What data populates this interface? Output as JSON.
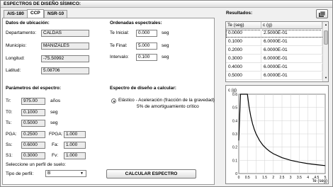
{
  "window": {
    "title": "ESPECTROS DE DISEÑO SÍSMICO:"
  },
  "tabs": [
    {
      "label": "AIS-180",
      "active": false
    },
    {
      "label": "CCP",
      "active": true
    },
    {
      "label": "NSR-10",
      "active": false
    }
  ],
  "ubicacion": {
    "title": "Datos de ubicación:",
    "departamento": {
      "label": "Departamento:",
      "value": "CALDAS"
    },
    "municipio": {
      "label": "Municipio:",
      "value": "MANIZALES"
    },
    "longitud": {
      "label": "Longitud:",
      "value": "-75.50992"
    },
    "latitud": {
      "label": "Latitud:",
      "value": "5.08706"
    }
  },
  "ordenadas": {
    "title": "Ordenadas espectrales:",
    "t_inicial": {
      "label": "Te Inicial:",
      "value": "0.000",
      "unit": "seg"
    },
    "t_final": {
      "label": "Te Final:",
      "value": "5.000",
      "unit": "seg"
    },
    "intervalo": {
      "label": "Intervalo:",
      "value": "0.100",
      "unit": "seg"
    }
  },
  "parametros": {
    "title": "Parámetros del espectro:",
    "tr": {
      "label": "Tr:",
      "value": "975.00",
      "unit": "años"
    },
    "t0": {
      "label": "T0:",
      "value": "0.1000",
      "unit": "seg"
    },
    "ts": {
      "label": "Ts:",
      "value": "0.5000",
      "unit": "seg"
    },
    "pga": {
      "label": "PGA:",
      "value": "0.2500"
    },
    "fpga": {
      "label": "FPGA:",
      "value": "1.000"
    },
    "ss": {
      "label": "Ss:",
      "value": "0.6000"
    },
    "fa": {
      "label": "Fa:",
      "value": "1.000"
    },
    "s1": {
      "label": "S1:",
      "value": "0.3000"
    },
    "fv": {
      "label": "Fv:",
      "value": "1.000"
    },
    "perfil_prompt": "Seleccione un perfil de suelo:",
    "perfil_label": "Tipo de perfil:",
    "perfil_value": "B"
  },
  "espectro": {
    "title": "Espectro de diseño a calcular:",
    "option_line1": "Elástico - Aceleración (fracción de la gravedad)",
    "option_line2": "5% de amortiguamiento crítico",
    "option_selected": true
  },
  "buttons": {
    "calcular": "CALCULAR ESPECTRO"
  },
  "results": {
    "title": "Resultados:",
    "icon": "export-icon",
    "columns": [
      "Te (seg)",
      "c (g)"
    ],
    "rows": [
      [
        "0.0000",
        "2.5000E-01"
      ],
      [
        "0.1000",
        "6.0000E-01"
      ],
      [
        "0.2000",
        "6.0000E-01"
      ],
      [
        "0.3000",
        "6.0000E-01"
      ],
      [
        "0.4000",
        "6.0000E-01"
      ],
      [
        "0.5000",
        "6.0000E-01"
      ]
    ]
  },
  "chart_data": {
    "type": "line",
    "title": "",
    "ylabel": "c (g)",
    "xlabel": "Te (seg)",
    "xlim": [
      0,
      5
    ],
    "ylim": [
      0,
      0.6
    ],
    "xticks": [
      "0",
      "0.5",
      "1",
      "1.5",
      "2",
      "2.5",
      "3",
      "3.5",
      "4",
      "4.5",
      "5"
    ],
    "yticks": [
      "0",
      "0.1",
      "0.2",
      "0.3",
      "0.4",
      "0.5",
      "0.6"
    ],
    "grid": true,
    "line_color": "#000000",
    "series": [
      {
        "x": [
          0,
          0.1,
          0.2,
          0.3,
          0.4,
          0.5,
          0.6,
          0.7,
          0.8,
          0.9,
          1.0,
          1.2,
          1.4,
          1.6,
          1.8,
          2.0,
          2.5,
          3.0,
          3.5,
          4.0,
          4.5,
          5.0
        ],
        "values": [
          0.25,
          0.6,
          0.6,
          0.6,
          0.6,
          0.6,
          0.5,
          0.429,
          0.375,
          0.333,
          0.3,
          0.25,
          0.214,
          0.188,
          0.167,
          0.15,
          0.12,
          0.1,
          0.086,
          0.075,
          0.067,
          0.06
        ]
      }
    ]
  }
}
